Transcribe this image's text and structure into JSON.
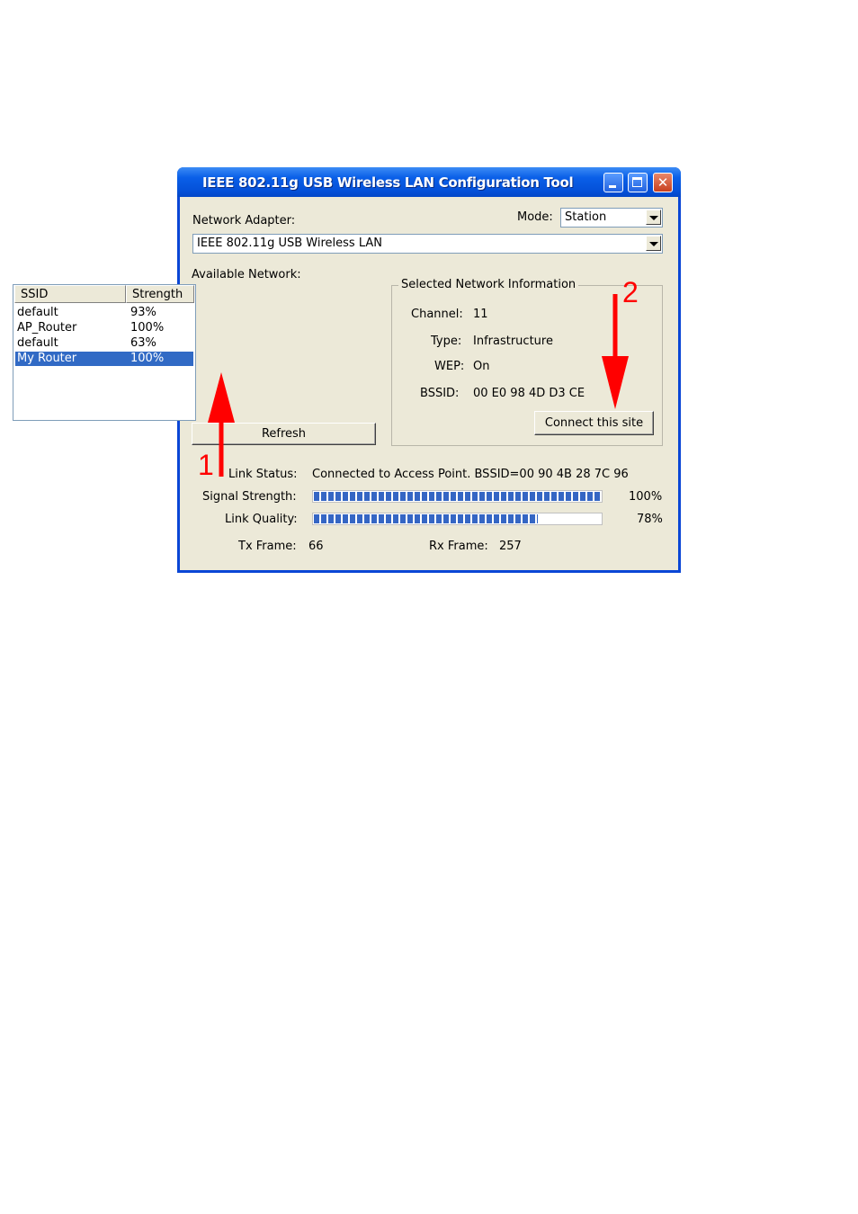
{
  "window": {
    "title": "IEEE 802.11g USB Wireless LAN Configuration Tool"
  },
  "adapter": {
    "label": "Network Adapter:",
    "value": "IEEE 802.11g USB Wireless LAN"
  },
  "mode": {
    "label": "Mode:",
    "value": "Station"
  },
  "available": {
    "label": "Available Network:",
    "col_ssid": "SSID",
    "col_strength": "Strength",
    "rows": [
      {
        "ssid": "default",
        "strength": "93%"
      },
      {
        "ssid": "AP_Router",
        "strength": "100%"
      },
      {
        "ssid": "default",
        "strength": "63%"
      },
      {
        "ssid": "My Router",
        "strength": "100%"
      }
    ],
    "selected_index": 3,
    "refresh_label": "Refresh"
  },
  "info": {
    "title": "Selected Network Information",
    "channel_label": "Channel:",
    "channel": "11",
    "type_label": "Type:",
    "type": "Infrastructure",
    "wep_label": "WEP:",
    "wep": "On",
    "bssid_label": "BSSID:",
    "bssid": "00 E0 98 4D D3 CE",
    "connect_label": "Connect this site"
  },
  "status": {
    "link_label": "Link Status:",
    "link_value": "Connected to Access Point. BSSID=00 90 4B 28 7C 96",
    "signal_label": "Signal Strength:",
    "signal_percent": "100%",
    "signal_level": 1.0,
    "quality_label": "Link Quality:",
    "quality_percent": "78%",
    "quality_level": 0.78,
    "tx_label": "Tx Frame:",
    "tx": "66",
    "rx_label": "Rx Frame:",
    "rx": "257"
  },
  "annotations": {
    "step1": "1",
    "step2": "2",
    "arrow_color": "#ff0000"
  }
}
